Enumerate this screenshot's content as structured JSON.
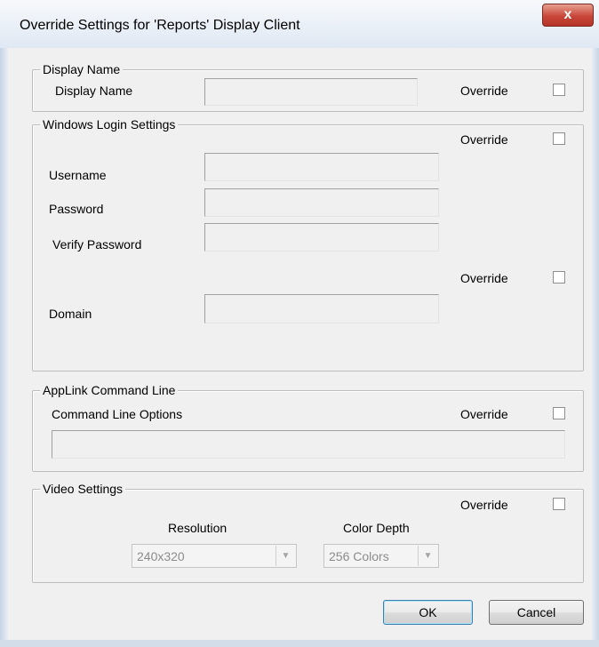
{
  "window": {
    "title": "Override Settings for 'Reports' Display Client",
    "close_glyph": "x"
  },
  "display_name_group": {
    "legend": "Display Name",
    "field_label": "Display Name",
    "field_value": "",
    "override_label": "Override",
    "override_checked": false
  },
  "windows_login_group": {
    "legend": "Windows Login Settings",
    "override_label": "Override",
    "override_checked": false,
    "username_label": "Username",
    "username_value": "",
    "password_label": "Password",
    "password_value": "",
    "verify_password_label": "Verify Password",
    "verify_password_value": "",
    "domain_override_label": "Override",
    "domain_override_checked": false,
    "domain_label": "Domain",
    "domain_value": ""
  },
  "applink_group": {
    "legend": "AppLink Command Line",
    "options_label": "Command Line Options",
    "options_value": "",
    "override_label": "Override",
    "override_checked": false
  },
  "video_group": {
    "legend": "Video Settings",
    "override_label": "Override",
    "override_checked": false,
    "resolution_label": "Resolution",
    "resolution_value": "240x320",
    "color_depth_label": "Color Depth",
    "color_depth_value": "256 Colors"
  },
  "buttons": {
    "ok_label": "OK",
    "cancel_label": "Cancel"
  }
}
